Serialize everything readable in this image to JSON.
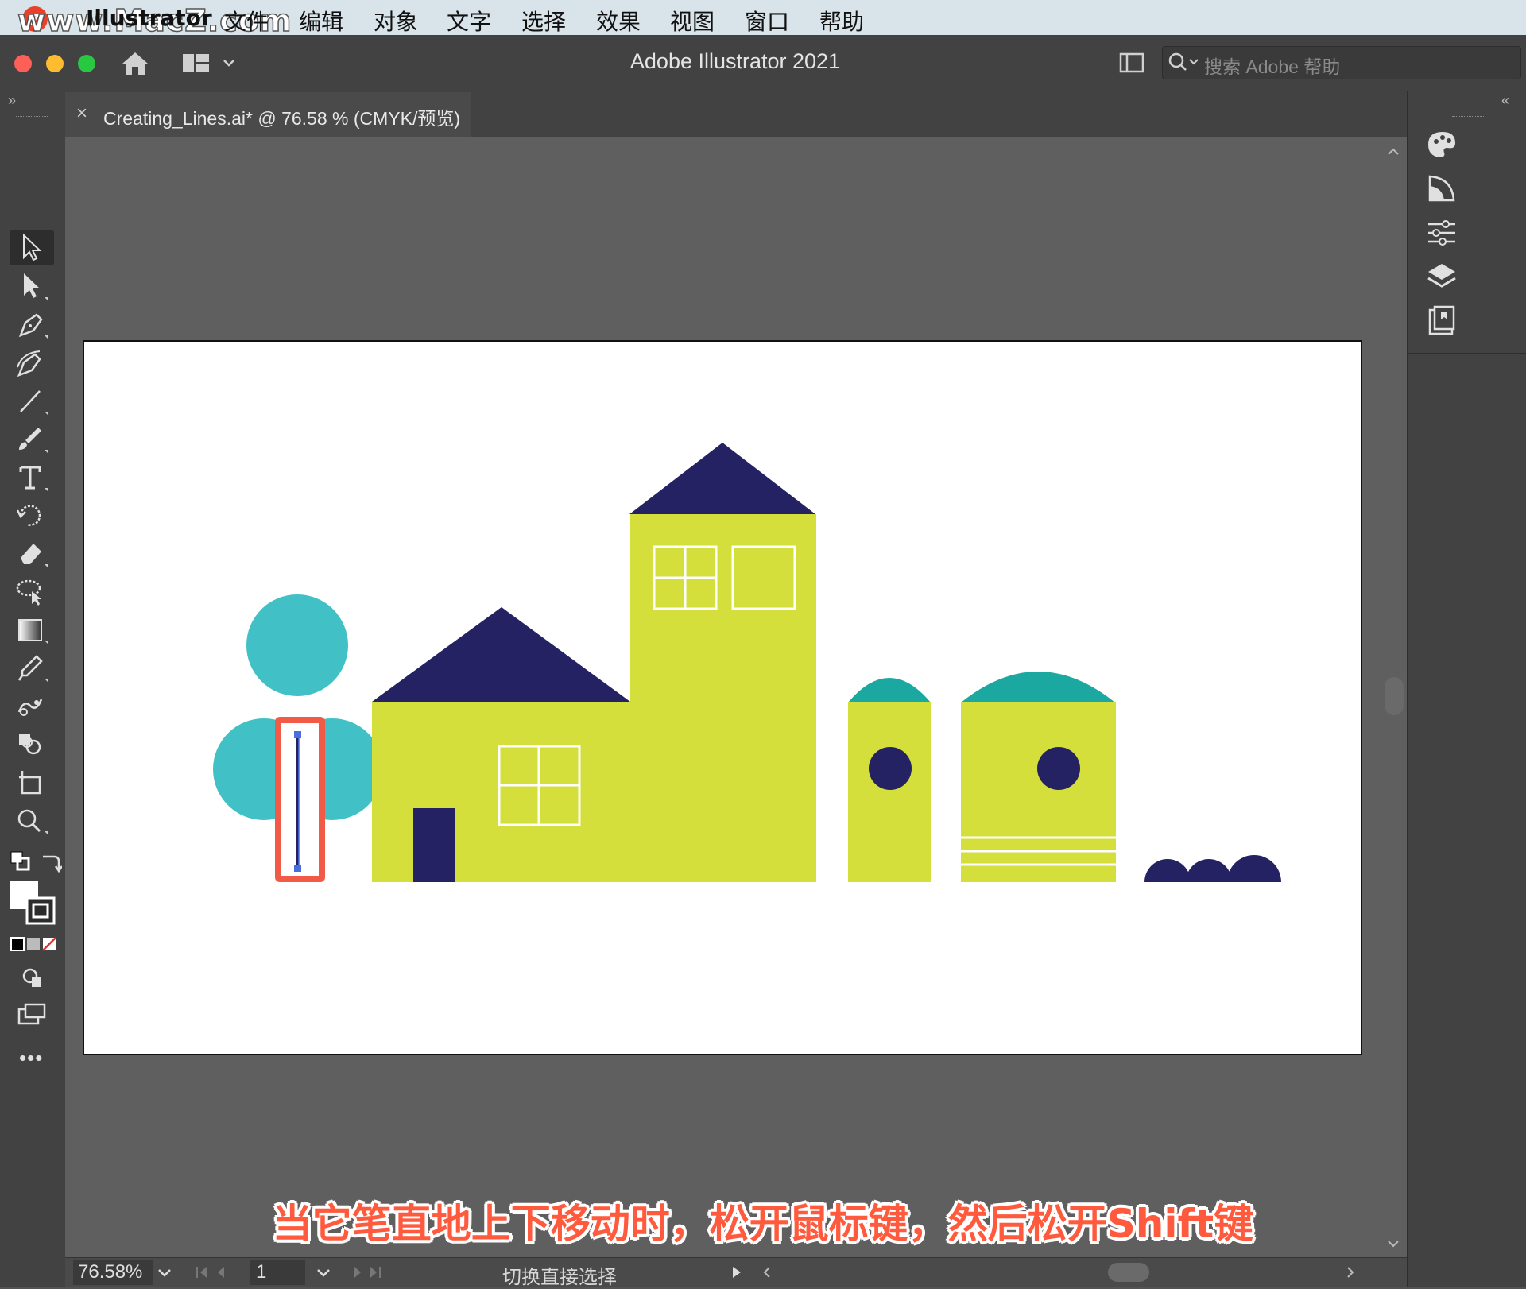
{
  "menubar": {
    "watermark": "www.MacZ.com",
    "logo_letter": "z",
    "app_name": "Illustrator",
    "items": [
      "文件",
      "编辑",
      "对象",
      "文字",
      "选择",
      "效果",
      "视图",
      "窗口",
      "帮助"
    ]
  },
  "titlebar": {
    "title": "Adobe Illustrator 2021",
    "search_placeholder": "搜索 Adobe 帮助"
  },
  "document_tab": {
    "close": "×",
    "label": "Creating_Lines.ai* @ 76.58 % (CMYK/预览)"
  },
  "tools": [
    {
      "icon": "selection-tool-icon"
    },
    {
      "icon": "direct-selection-tool-icon"
    },
    {
      "icon": "pen-tool-icon"
    },
    {
      "icon": "curvature-tool-icon"
    },
    {
      "icon": "line-segment-tool-icon"
    },
    {
      "icon": "paintbrush-tool-icon"
    },
    {
      "icon": "type-tool-icon"
    },
    {
      "icon": "rotate-tool-icon"
    },
    {
      "icon": "eraser-tool-icon"
    },
    {
      "icon": "lasso-tool-icon"
    },
    {
      "icon": "gradient-tool-icon"
    },
    {
      "icon": "eyedropper-tool-icon"
    },
    {
      "icon": "puppet-warp-tool-icon"
    },
    {
      "icon": "shape-builder-tool-icon"
    },
    {
      "icon": "artboard-tool-icon"
    },
    {
      "icon": "zoom-tool-icon"
    }
  ],
  "toolbar_more": "•••",
  "right_panel_icons": [
    "color-palette-icon",
    "color-guide-icon",
    "properties-icon",
    "layers-icon",
    "libraries-icon"
  ],
  "status": {
    "zoom": "76.58%",
    "page": "1",
    "tool_hint": "切换直接选择"
  },
  "caption": "当它笔直地上下移动时，松开鼠标键，然后松开Shift键",
  "colors": {
    "lime": "#d5df3c",
    "navy": "#242263",
    "teal_light": "#41c1c5",
    "teal_dark": "#1aa8a0",
    "highlight_red": "#f25a48",
    "selection_blue": "#4a6ee0"
  }
}
